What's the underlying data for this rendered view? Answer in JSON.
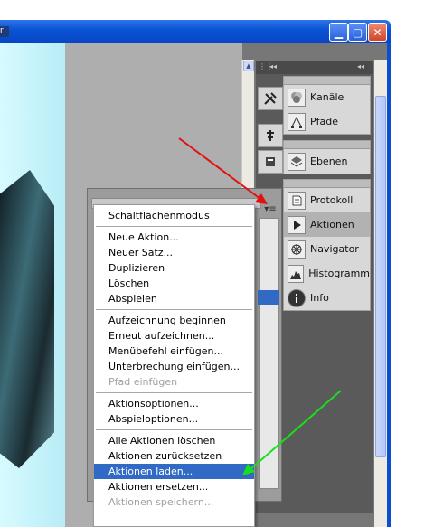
{
  "window": {
    "clip_label": "r",
    "minimize_label": "▁",
    "maximize_label": "▢",
    "close_label": "✕"
  },
  "dock": {
    "collapse_left": "◂◂",
    "collapse_right": "◂◂",
    "expand": "▸▸"
  },
  "panels": {
    "group1": [
      {
        "label": "Kanäle",
        "icon": "channels-icon"
      },
      {
        "label": "Pfade",
        "icon": "paths-icon"
      }
    ],
    "group2": [
      {
        "label": "Ebenen",
        "icon": "layers-icon"
      }
    ],
    "group3": [
      {
        "label": "Protokoll",
        "icon": "history-icon"
      },
      {
        "label": "Aktionen",
        "icon": "actions-icon",
        "active": true
      },
      {
        "label": "Navigator",
        "icon": "navigator-icon"
      },
      {
        "label": "Histogramm",
        "icon": "histogram-icon"
      },
      {
        "label": "Info",
        "icon": "info-icon"
      }
    ]
  },
  "panel_menu_button": "▾≡",
  "menu": {
    "item_00": "Schaltflächenmodus",
    "item_01": "Neue Aktion...",
    "item_02": "Neuer Satz...",
    "item_03": "Duplizieren",
    "item_04": "Löschen",
    "item_05": "Abspielen",
    "item_06": "Aufzeichnung beginnen",
    "item_07": "Erneut aufzeichnen...",
    "item_08": "Menübefehl einfügen...",
    "item_09": "Unterbrechung einfügen...",
    "item_10": "Pfad einfügen",
    "item_11": "Aktionsoptionen...",
    "item_12": "Abspieloptionen...",
    "item_13": "Alle Aktionen löschen",
    "item_14": "Aktionen zurücksetzen",
    "item_15": "Aktionen laden...",
    "item_16": "Aktionen ersetzen...",
    "item_17": "Aktionen speichern..."
  },
  "colors": {
    "annotation_red": "#e21010",
    "annotation_green": "#18e018",
    "menu_highlight": "#316ac5",
    "titlebar": "#0a54d6"
  }
}
